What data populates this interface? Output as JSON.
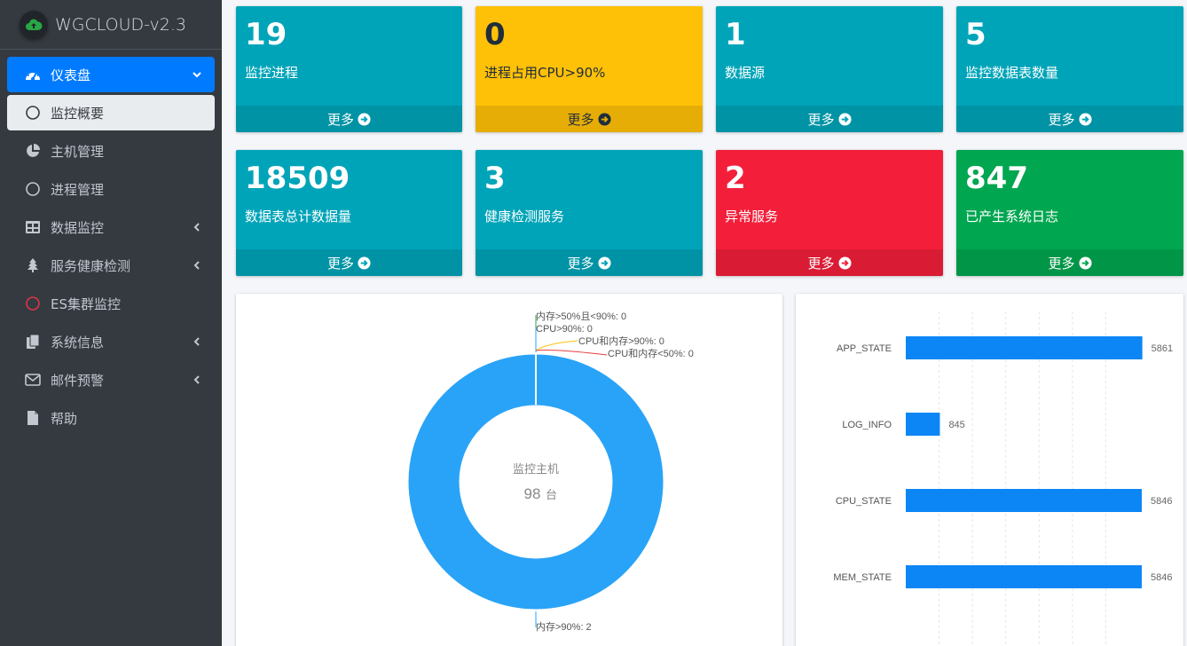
{
  "brand": {
    "title": "WGCLOUD-v2.3"
  },
  "sidebar": {
    "items": [
      {
        "label": "仪表盘",
        "icon": "dashboard-icon"
      },
      {
        "label": "监控概要",
        "icon": "circle-icon"
      },
      {
        "label": "主机管理",
        "icon": "pie-chart-icon"
      },
      {
        "label": "进程管理",
        "icon": "circle-icon"
      },
      {
        "label": "数据监控",
        "icon": "table-icon"
      },
      {
        "label": "服务健康检测",
        "icon": "tree-icon"
      },
      {
        "label": "ES集群监控",
        "icon": "circle-icon-red"
      },
      {
        "label": "系统信息",
        "icon": "copy-icon"
      },
      {
        "label": "邮件预警",
        "icon": "envelope-icon"
      },
      {
        "label": "帮助",
        "icon": "file-icon"
      }
    ]
  },
  "cards": [
    {
      "value": "19",
      "label": "监控进程",
      "more": "更多",
      "color": "#00a4b8"
    },
    {
      "value": "0",
      "label": "进程占用CPU>90%",
      "more": "更多",
      "color": "#ffc107"
    },
    {
      "value": "1",
      "label": "数据源",
      "more": "更多",
      "color": "#00a4b8"
    },
    {
      "value": "5",
      "label": "监控数据表数量",
      "more": "更多",
      "color": "#00a4b8"
    },
    {
      "value": "18509",
      "label": "数据表总计数据量",
      "more": "更多",
      "color": "#00a4b8"
    },
    {
      "value": "3",
      "label": "健康检测服务",
      "more": "更多",
      "color": "#00a4b8"
    },
    {
      "value": "2",
      "label": "异常服务",
      "more": "更多",
      "color": "#f31f3a"
    },
    {
      "value": "847",
      "label": "已产生系统日志",
      "more": "更多",
      "color": "#00a650"
    }
  ],
  "donut": {
    "center_title": "监控主机",
    "center_value": "98",
    "center_unit": "台",
    "labels": {
      "mem_50_90": "内存>50%且<90%: 0",
      "cpu_90": "CPU>90%: 0",
      "cpu_mem_90": "CPU和内存>90%: 0",
      "cpu_mem_50": "CPU和内存<50%: 0",
      "mem_90": "内存>90%: 2"
    },
    "colors": {
      "main": "#29a3f7",
      "green": "#28a745",
      "yellow": "#ffc107",
      "red": "#e83e3e"
    }
  },
  "chart_data": {
    "type": "bar",
    "orientation": "horizontal",
    "categories": [
      "APP_STATE",
      "LOG_INFO",
      "CPU_STATE",
      "MEM_STATE"
    ],
    "values": [
      5861,
      845,
      5846,
      5846
    ],
    "xlim": [
      0,
      6000
    ],
    "color": "#0d86f5",
    "grid": true
  }
}
